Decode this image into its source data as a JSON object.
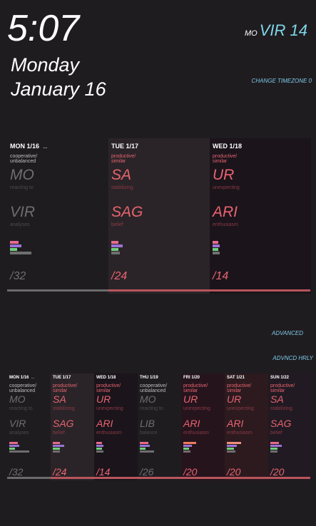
{
  "header": {
    "time": "5:07",
    "day": "Monday",
    "date": "January  16",
    "moon_prefix": "MO",
    "moon_value": "VIR 14",
    "change_tz": "CHANGE TIMEZONE 0"
  },
  "links": {
    "advanced": "ADVANCED",
    "advanced_hourly": "ADVNCD HRLY"
  },
  "colors": {
    "background": "#1f1c20",
    "accent_link": "#7fcbe8",
    "moon_value": "#7fd8ea",
    "productive": "#e86470",
    "neutral": "#6e6e6e",
    "bar_pink": "#e86a8e",
    "bar_purple": "#9b73d6",
    "bar_green": "#6fd07a",
    "bar_orange": "#f07a5a",
    "bar_salmon": "#f0907e",
    "progress_red": "#b8555c"
  },
  "days3": [
    {
      "label": "MON 1/16",
      "extra": "...",
      "desc": "cooperative/\nunbalanced",
      "sign1": "MO",
      "sub1": "reacting to",
      "sign2": "VIR",
      "sub2": "analyses",
      "count": "/32",
      "mood": "neutral"
    },
    {
      "label": "TUE 1/17",
      "extra": "",
      "desc": "productive/\nsimilar",
      "sign1": "SA",
      "sub1": "stabilizing",
      "sign2": "SAG",
      "sub2": "belief",
      "count": "/24",
      "mood": "productive"
    },
    {
      "label": "WED 1/18",
      "extra": "",
      "desc": "productive/\nsimilar",
      "sign1": "UR",
      "sub1": "unexpecting",
      "sign2": "ARI",
      "sub2": "enthusiasm",
      "count": "/14",
      "mood": "productive"
    }
  ],
  "days7": [
    {
      "label": "MON 1/16",
      "extra": "...",
      "desc": "cooperative/\nunbalanced",
      "sign1": "MO",
      "sub1": "reacting to",
      "sign2": "VIR",
      "sub2": "analyses",
      "count": "/32",
      "mood": "neutral"
    },
    {
      "label": "TUE 1/17",
      "extra": "",
      "desc": "productive/\nsimilar",
      "sign1": "SA",
      "sub1": "stabilizing",
      "sign2": "SAG",
      "sub2": "belief",
      "count": "/24",
      "mood": "productive"
    },
    {
      "label": "WED 1/18",
      "extra": "",
      "desc": "productive/\nsimilar",
      "sign1": "UR",
      "sub1": "unexpecting",
      "sign2": "ARI",
      "sub2": "enthusiasm",
      "count": "/14",
      "mood": "productive"
    },
    {
      "label": "THU 1/19",
      "extra": "",
      "desc": "cooperative/\nunbalanced",
      "sign1": "MO",
      "sub1": "reacting to",
      "sign2": "LIB",
      "sub2": "balance",
      "count": "/26",
      "mood": "neutral"
    },
    {
      "label": "FRI 1/20",
      "extra": "",
      "desc": "productive/\nsimilar",
      "sign1": "UR",
      "sub1": "unexpecting",
      "sign2": "ARI",
      "sub2": "enthusiasm",
      "count": "/20",
      "mood": "productive"
    },
    {
      "label": "SAT 1/21",
      "extra": "",
      "desc": "productive/\nsimilar",
      "sign1": "UR",
      "sub1": "unexpecting",
      "sign2": "ARI",
      "sub2": "enthusiasm",
      "count": "/20",
      "mood": "productive"
    },
    {
      "label": "SUN 1/22",
      "extra": "",
      "desc": "productive/\nsimilar",
      "sign1": "SA",
      "sub1": "stabilizing",
      "sign2": "SAG",
      "sub2": "belief",
      "count": "/20",
      "mood": "productive"
    }
  ]
}
